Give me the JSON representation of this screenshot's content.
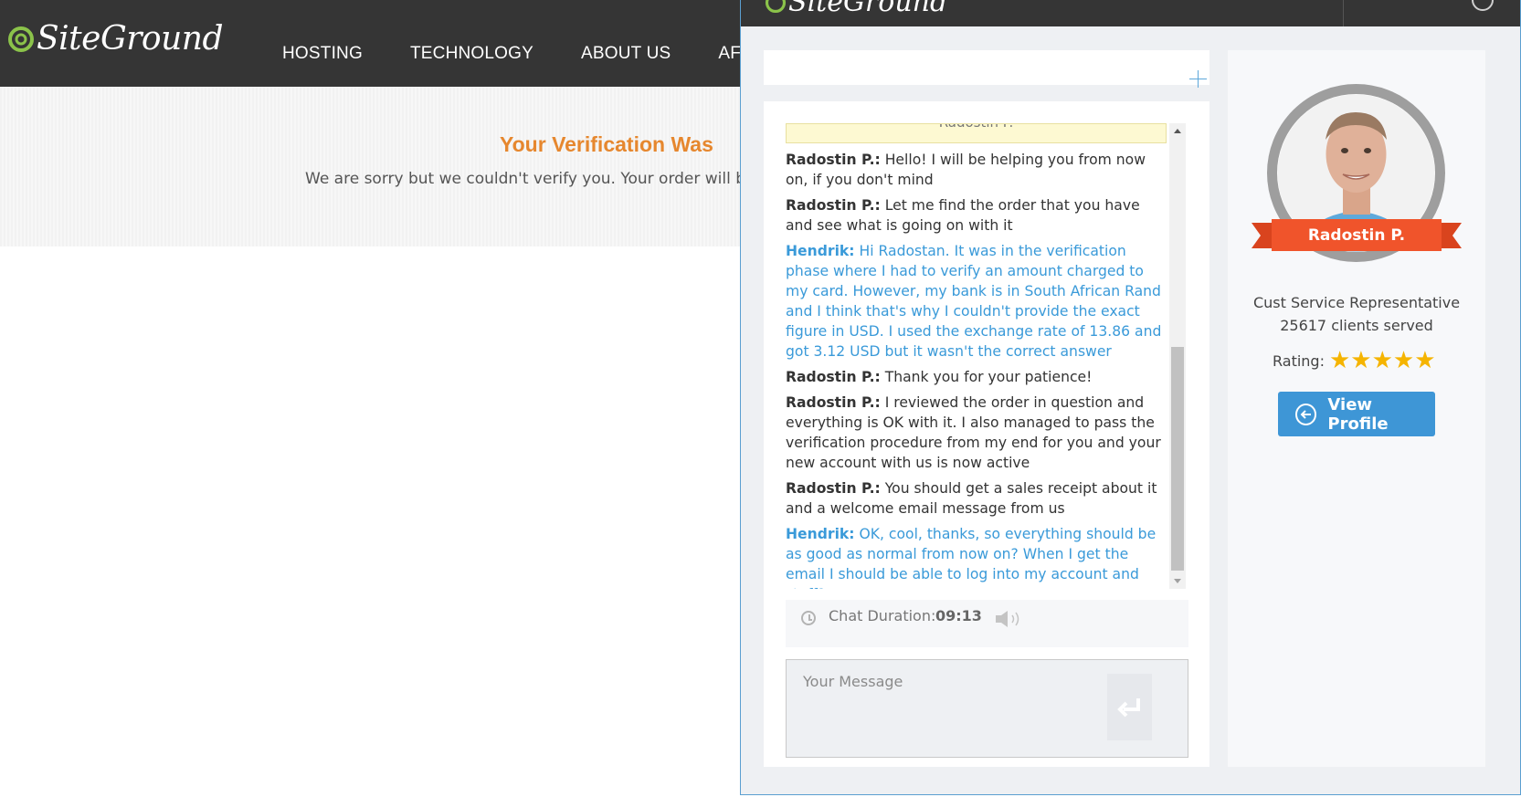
{
  "site": {
    "logo_text": "SiteGround",
    "nav": [
      "HOSTING",
      "TECHNOLOGY",
      "ABOUT US",
      "AFFILI"
    ],
    "hero_title": "Your Verification Was",
    "hero_text": "We are sorry but we couldn't verify you. Your order will be"
  },
  "chat": {
    "header_logo_text": "SiteGround",
    "system_notice": "Radostin P.",
    "messages": [
      {
        "author": "Radostin P.:",
        "text": " Hello! I will be helping you from now on, if you don't mind",
        "role": "agent"
      },
      {
        "author": "Radostin P.:",
        "text": " Let me find the order that you have and see what is going on with it",
        "role": "agent"
      },
      {
        "author": "Hendrik:",
        "text": " Hi Radostan. It was in the verification phase where I had to verify an amount charged to my card. However, my bank is in South African Rand and I think that's why I couldn't provide the exact figure in USD. I used the exchange rate of 13.86 and got 3.12 USD but it wasn't the correct answer",
        "role": "client"
      },
      {
        "author": "Radostin P.:",
        "text": " Thank you for your patience!",
        "role": "agent"
      },
      {
        "author": "Radostin P.:",
        "text": " I reviewed the order in question and everything is OK with it. I also managed to pass the verification procedure from my end for you and your new account with us is now active",
        "role": "agent"
      },
      {
        "author": "Radostin P.:",
        "text": " You should get a sales receipt about it and a welcome email message from us",
        "role": "agent"
      },
      {
        "author": "Hendrik:",
        "text": " OK, cool, thanks, so everything should be as good as normal from now on? When I get the email I should be able to log into my account and stuff?",
        "role": "client"
      }
    ],
    "duration_label": "Chat Duration:",
    "duration_value": "09:13",
    "input_placeholder": "Your Message"
  },
  "agent": {
    "name": "Radostin P.",
    "role": "Cust Service Representative",
    "clients_served": "25617 clients served",
    "rating_label": "Rating:",
    "rating_stars": "★★★★★",
    "rating_value": 5,
    "view_profile_label": "View Profile"
  },
  "colors": {
    "header_bg": "#353535",
    "hero_title": "#e6872e",
    "client_text": "#3a9ad9",
    "accent_blue": "#3e96d6",
    "ribbon": "#f0542b",
    "star": "#f5b400"
  },
  "icons": [
    "siteground-logo-icon",
    "plus-icon",
    "clock-icon",
    "speaker-icon",
    "send-enter-icon",
    "arrow-left-icon",
    "star-icon"
  ]
}
